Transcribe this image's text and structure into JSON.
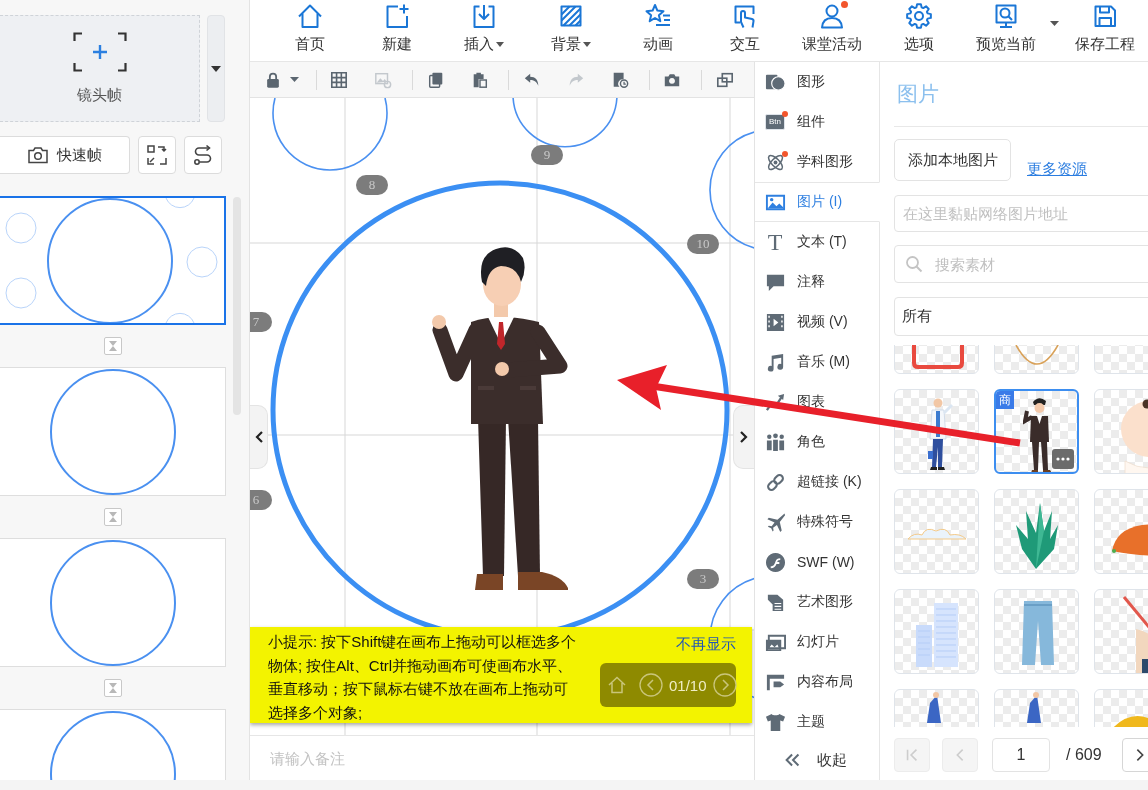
{
  "left_panel": {
    "add_frame": {
      "label": "镜头帧"
    },
    "quick_frame": {
      "label": "快速帧"
    },
    "slides": [
      {
        "kind": "cluster",
        "selected": true
      },
      {
        "kind": "circle",
        "selected": false
      },
      {
        "kind": "circle",
        "selected": false
      },
      {
        "kind": "circle",
        "selected": false
      }
    ]
  },
  "toolbar": {
    "items": [
      {
        "label": "首页",
        "kind": "button",
        "dropdown": false,
        "dot": false
      },
      {
        "label": "新建",
        "kind": "button",
        "dropdown": false,
        "dot": false
      },
      {
        "label": "插入",
        "kind": "button",
        "dropdown": true,
        "dot": false
      },
      {
        "label": "背景",
        "kind": "button",
        "dropdown": true,
        "dot": false
      },
      {
        "label": "动画",
        "kind": "button",
        "dropdown": false,
        "dot": false
      },
      {
        "label": "交互",
        "kind": "button",
        "dropdown": false,
        "dot": false
      },
      {
        "label": "课堂活动",
        "kind": "button",
        "dropdown": false,
        "dot": true
      },
      {
        "label": "选项",
        "kind": "button",
        "dropdown": false,
        "dot": false
      },
      {
        "label": "预览当前",
        "kind": "split",
        "dropdown": true,
        "dot": false
      },
      {
        "label": "保存工程",
        "kind": "button",
        "dropdown": false,
        "dot": false
      }
    ]
  },
  "canvas_toolbar": {
    "tools": [
      {
        "disabled": false
      },
      {
        "disabled": false
      },
      {
        "disabled": true
      },
      {
        "disabled": false
      },
      {
        "disabled": false
      },
      {
        "disabled": false
      },
      {
        "disabled": true
      },
      {
        "disabled": false
      },
      {
        "disabled": false
      },
      {
        "disabled": false
      }
    ]
  },
  "canvas": {
    "badges": [
      "9",
      "8",
      "10",
      "7",
      "6",
      "3"
    ],
    "tip": {
      "text": "小提示: 按下Shift键在画布上拖动可以框选多个物体; 按住Alt、Ctrl并拖动画布可使画布水平、垂直移动；按下鼠标右键不放在画布上拖动可选择多个对象;",
      "dismiss": "不再显示"
    },
    "player": {
      "counter": "01/10"
    }
  },
  "notes": {
    "placeholder": "请输入备注"
  },
  "categories": {
    "items": [
      {
        "label": "图形",
        "selected": false,
        "dot": false
      },
      {
        "label": "组件",
        "selected": false,
        "dot": true,
        "icon_label": "Btn"
      },
      {
        "label": "学科图形",
        "selected": false,
        "dot": true
      },
      {
        "label": "图片 (I)",
        "selected": true,
        "dot": false
      },
      {
        "label": "文本 (T)",
        "selected": false,
        "dot": false,
        "icon_label": "T"
      },
      {
        "label": "注释",
        "selected": false,
        "dot": false
      },
      {
        "label": "视频 (V)",
        "selected": false,
        "dot": false
      },
      {
        "label": "音乐 (M)",
        "selected": false,
        "dot": false
      },
      {
        "label": "图表",
        "selected": false,
        "dot": false
      },
      {
        "label": "角色",
        "selected": false,
        "dot": false
      },
      {
        "label": "超链接 (K)",
        "selected": false,
        "dot": false
      },
      {
        "label": "特殊符号",
        "selected": false,
        "dot": false
      },
      {
        "label": "SWF (W)",
        "selected": false,
        "dot": false
      },
      {
        "label": "艺术图形",
        "selected": false,
        "dot": false
      },
      {
        "label": "幻灯片",
        "selected": false,
        "dot": false
      },
      {
        "label": "内容布局",
        "selected": false,
        "dot": false
      },
      {
        "label": "主题",
        "selected": false,
        "dot": false
      }
    ],
    "collapse": "收起"
  },
  "images_panel": {
    "title": "图片",
    "add_button": "添加本地图片",
    "more_link": "更多资源",
    "url_field": {
      "placeholder": "在这里黏贴网络图片地址"
    },
    "search": {
      "placeholder": "搜索素材"
    },
    "filter": {
      "value": "所有"
    },
    "tiles": [
      {
        "kind": "frame",
        "selected": false
      },
      {
        "kind": "necklace",
        "selected": false
      },
      {
        "kind": "blank",
        "selected": false
      },
      {
        "kind": "doctor",
        "selected": false
      },
      {
        "kind": "businessman",
        "selected": true,
        "badge": "商"
      },
      {
        "kind": "baby",
        "selected": false
      },
      {
        "kind": "cloud",
        "selected": false
      },
      {
        "kind": "plant",
        "selected": false
      },
      {
        "kind": "food",
        "selected": false
      },
      {
        "kind": "buildings",
        "selected": false
      },
      {
        "kind": "jeans",
        "selected": false
      },
      {
        "kind": "hand",
        "selected": false
      },
      {
        "kind": "figure",
        "selected": false
      },
      {
        "kind": "figure",
        "selected": false
      },
      {
        "kind": "dome",
        "selected": false
      }
    ],
    "pagination": {
      "buttons": [
        {
          "kind": "first",
          "disabled": true
        },
        {
          "kind": "prev",
          "disabled": true
        },
        {
          "kind": "next",
          "disabled": false
        }
      ],
      "page": "1",
      "total": "/ 609"
    }
  }
}
